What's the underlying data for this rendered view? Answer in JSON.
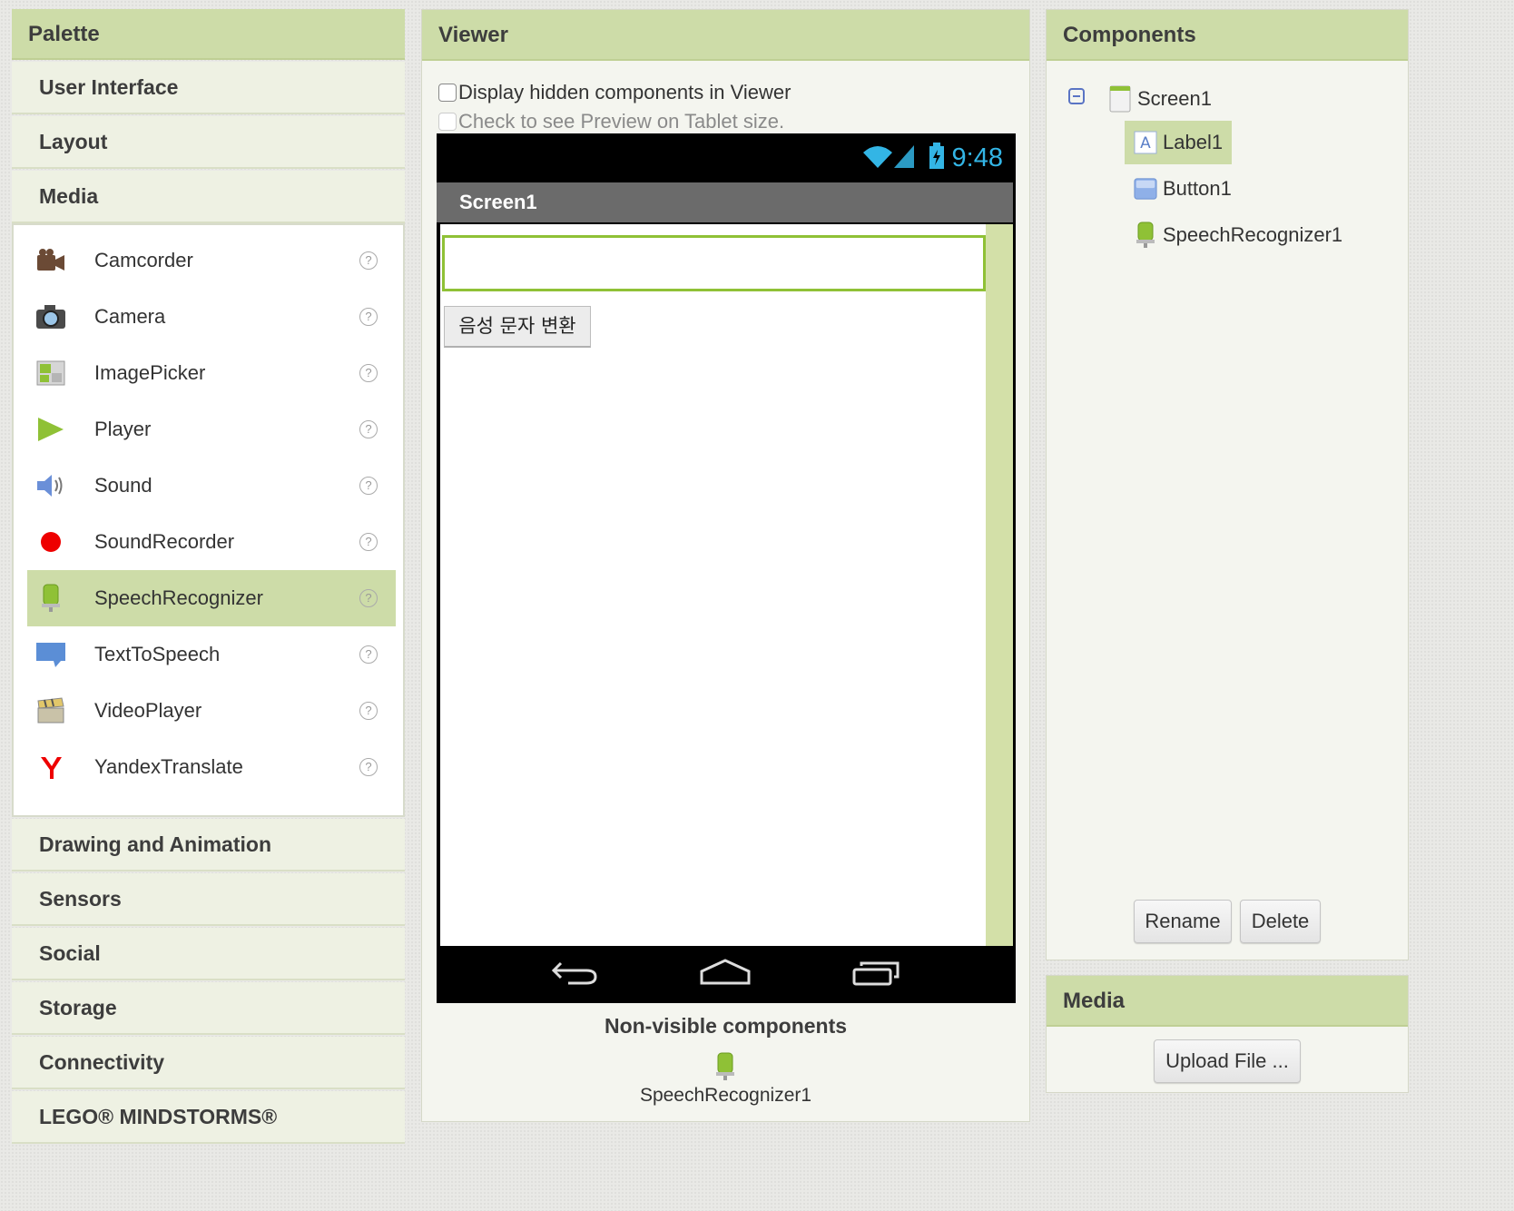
{
  "palette": {
    "title": "Palette",
    "categories_top": [
      "User Interface",
      "Layout",
      "Media"
    ],
    "media_items": [
      {
        "label": "Camcorder",
        "icon": "camcorder-icon"
      },
      {
        "label": "Camera",
        "icon": "camera-icon"
      },
      {
        "label": "ImagePicker",
        "icon": "imagepicker-icon"
      },
      {
        "label": "Player",
        "icon": "player-icon"
      },
      {
        "label": "Sound",
        "icon": "sound-icon"
      },
      {
        "label": "SoundRecorder",
        "icon": "soundrecorder-icon"
      },
      {
        "label": "SpeechRecognizer",
        "icon": "speechrecognizer-icon",
        "selected": true
      },
      {
        "label": "TextToSpeech",
        "icon": "texttospeech-icon"
      },
      {
        "label": "VideoPlayer",
        "icon": "videoplayer-icon"
      },
      {
        "label": "YandexTranslate",
        "icon": "yandextranslate-icon"
      }
    ],
    "help_glyph": "?",
    "categories_bottom": [
      "Drawing and Animation",
      "Sensors",
      "Social",
      "Storage",
      "Connectivity",
      "LEGO® MINDSTORMS®"
    ]
  },
  "viewer": {
    "title": "Viewer",
    "display_hidden_label": "Display hidden components in Viewer",
    "tablet_preview_label": "Check to see Preview on Tablet size.",
    "phone": {
      "time": "9:48",
      "screen_title": "Screen1",
      "button_text": "음성 문자 변환"
    },
    "nonvisible_title": "Non-visible components",
    "nonvisible_item": "SpeechRecognizer1"
  },
  "components": {
    "title": "Components",
    "tree": {
      "root": "Screen1",
      "children": [
        "Label1",
        "Button1",
        "SpeechRecognizer1"
      ]
    },
    "rename_label": "Rename",
    "delete_label": "Delete"
  },
  "media": {
    "title": "Media",
    "upload_label": "Upload File ..."
  },
  "colors": {
    "header_green": "#cddca8",
    "selection_green": "#cddca8",
    "label_border": "#8fc136",
    "status_blue": "#33b5e5"
  }
}
